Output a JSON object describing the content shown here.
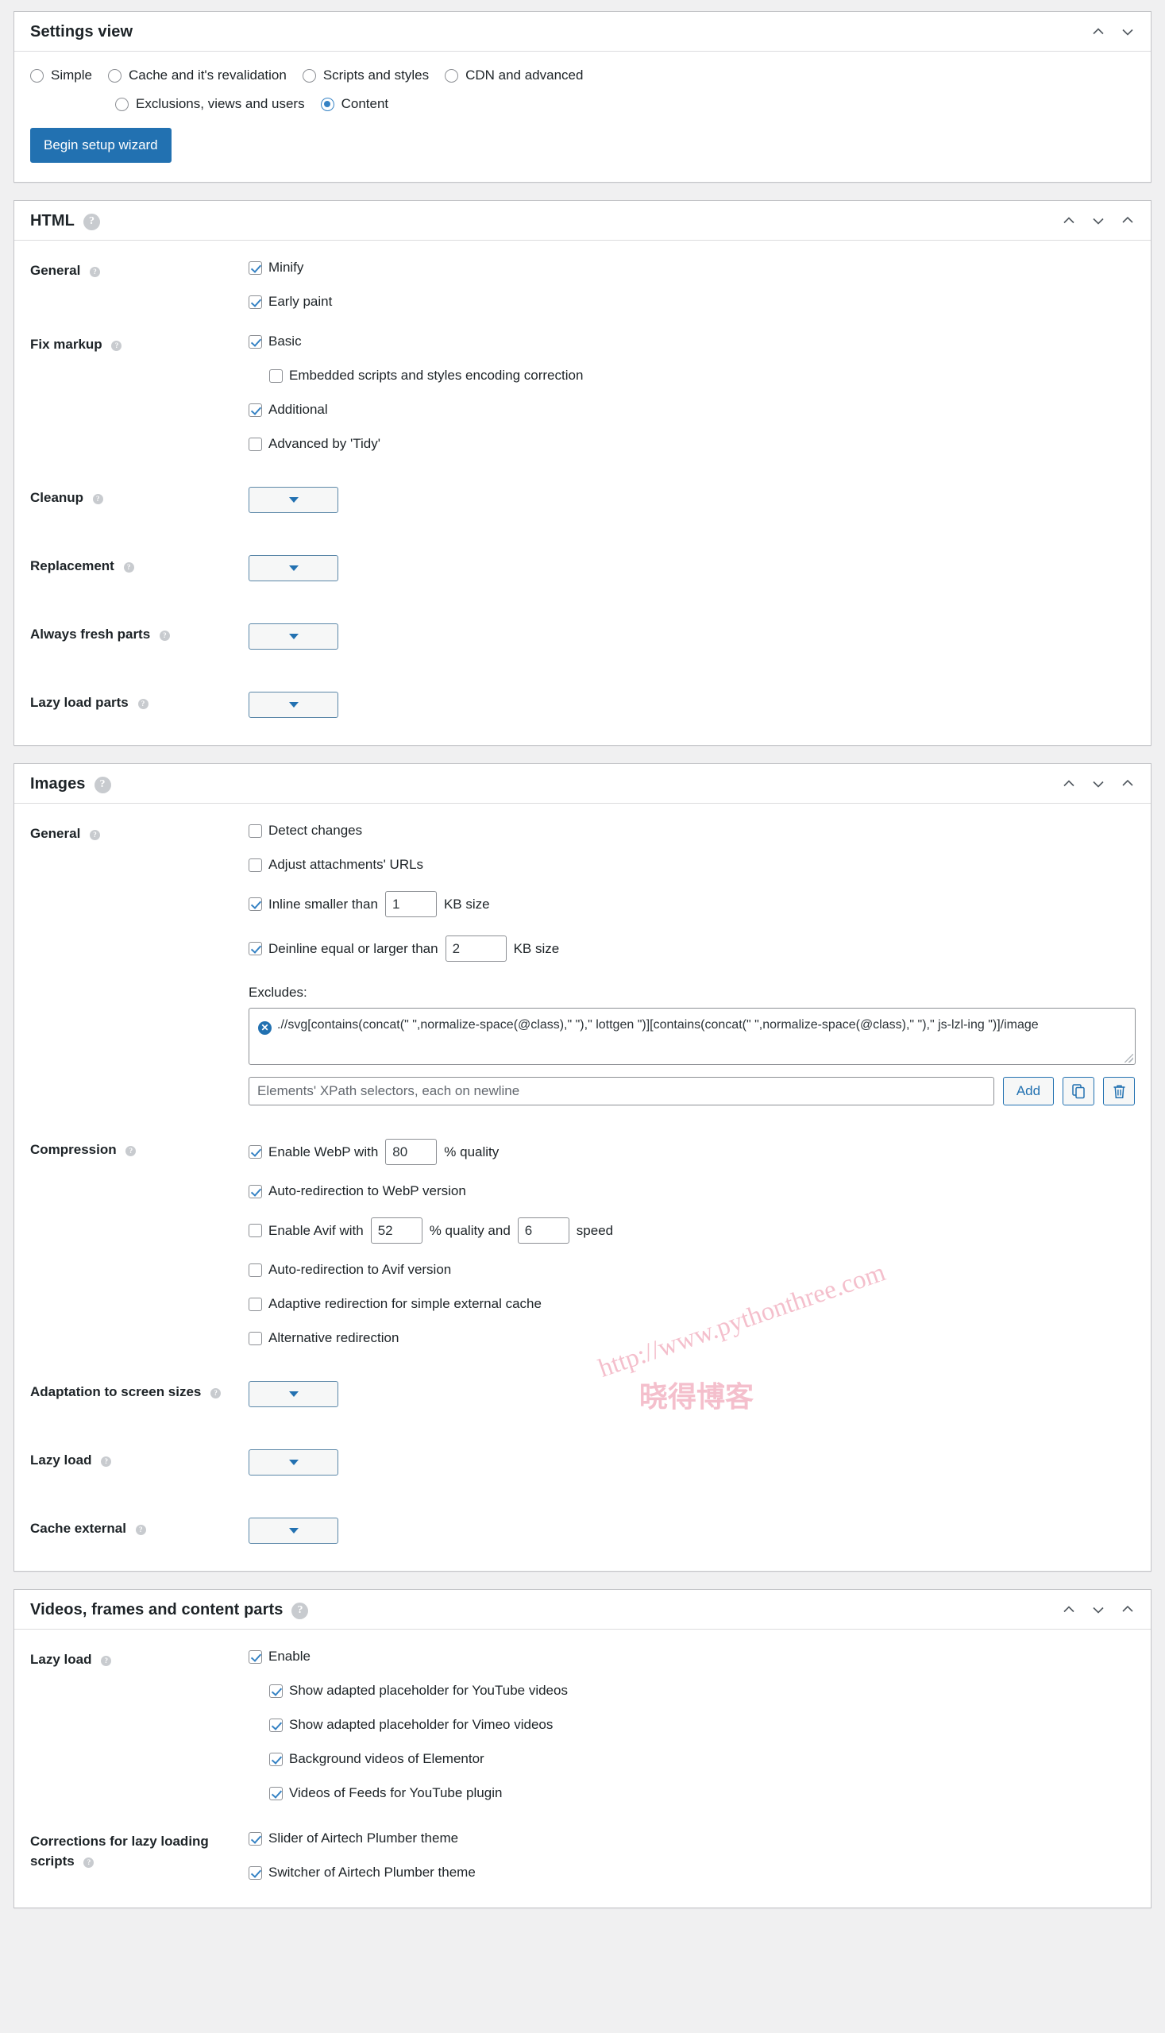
{
  "settings_view": {
    "title": "Settings view",
    "options": [
      {
        "label": "Simple",
        "checked": false
      },
      {
        "label": "Cache and it's revalidation",
        "checked": false
      },
      {
        "label": "Scripts and styles",
        "checked": false
      },
      {
        "label": "CDN and advanced",
        "checked": false
      },
      {
        "label": "Exclusions, views and users",
        "checked": false
      },
      {
        "label": "Content",
        "checked": true
      }
    ],
    "wizard_button": "Begin setup wizard"
  },
  "html_panel": {
    "title": "HTML",
    "rows": {
      "general": {
        "label": "General",
        "items": [
          {
            "label": "Minify",
            "checked": true
          },
          {
            "label": "Early paint",
            "checked": true
          }
        ]
      },
      "fix_markup": {
        "label": "Fix markup",
        "items": [
          {
            "label": "Basic",
            "checked": true,
            "indent": 0
          },
          {
            "label": "Embedded scripts and styles encoding correction",
            "checked": false,
            "indent": 1
          },
          {
            "label": "Additional",
            "checked": true,
            "indent": 0
          },
          {
            "label": "Advanced by 'Tidy'",
            "checked": false,
            "indent": 0
          }
        ]
      },
      "selects": [
        {
          "label": "Cleanup",
          "value": ""
        },
        {
          "label": "Replacement",
          "value": ""
        },
        {
          "label": "Always fresh parts",
          "value": ""
        },
        {
          "label": "Lazy load parts",
          "value": ""
        }
      ]
    }
  },
  "images_panel": {
    "title": "Images",
    "general": {
      "label": "General",
      "items": [
        {
          "label": "Detect changes",
          "checked": false
        },
        {
          "label": "Adjust attachments' URLs",
          "checked": false
        }
      ],
      "inline": {
        "label": "Inline smaller than",
        "checked": true,
        "value": "1",
        "unit": "KB size"
      },
      "deinline": {
        "label": "Deinline equal or larger than",
        "checked": true,
        "value": "2",
        "unit": "KB size"
      },
      "excludes": {
        "label": "Excludes:",
        "entry": ".//svg[contains(concat(\" \",normalize-space(@class),\" \"),\" lottgen \")][contains(concat(\" \",normalize-space(@class),\" \"),\" js-lzl-ing \")]/image",
        "input_placeholder": "Elements' XPath selectors, each on newline",
        "input_value": "",
        "add_label": "Add"
      }
    },
    "compression": {
      "label": "Compression",
      "webp": {
        "label": "Enable WebP with",
        "checked": true,
        "value": "80",
        "unit": "% quality"
      },
      "webp_redirect": {
        "label": "Auto-redirection to WebP version",
        "checked": true
      },
      "avif": {
        "label": "Enable Avif with",
        "checked": false,
        "quality": "52",
        "quality_unit": "% quality and",
        "speed": "6",
        "speed_unit": "speed"
      },
      "items": [
        {
          "label": "Auto-redirection to Avif version",
          "checked": false
        },
        {
          "label": "Adaptive redirection for simple external cache",
          "checked": false
        },
        {
          "label": "Alternative redirection",
          "checked": false
        }
      ]
    },
    "selects": [
      {
        "label": "Adaptation to screen sizes",
        "value": ""
      },
      {
        "label": "Lazy load",
        "value": ""
      },
      {
        "label": "Cache external",
        "value": ""
      }
    ]
  },
  "videos_panel": {
    "title": "Videos, frames and content parts",
    "lazy_load": {
      "label": "Lazy load",
      "items": [
        {
          "label": "Enable",
          "checked": true,
          "indent": 0
        },
        {
          "label": "Show adapted placeholder for YouTube videos",
          "checked": true,
          "indent": 1
        },
        {
          "label": "Show adapted placeholder for Vimeo videos",
          "checked": true,
          "indent": 1
        },
        {
          "label": "Background videos of Elementor",
          "checked": true,
          "indent": 1
        },
        {
          "label": "Videos of Feeds for YouTube plugin",
          "checked": true,
          "indent": 1
        }
      ]
    },
    "corrections": {
      "label": "Corrections for lazy loading scripts",
      "items": [
        {
          "label": "Slider of Airtech Plumber theme",
          "checked": true
        },
        {
          "label": "Switcher of Airtech Plumber theme",
          "checked": true
        }
      ]
    }
  },
  "watermark": {
    "url": "http://www.pythonthree.com",
    "text": "晓得博客"
  },
  "colors": {
    "accent": "#2271b1",
    "checkbox_check": "#3582c4",
    "panel_border": "#c3c4c7",
    "page_background": "#f0f0f1"
  }
}
